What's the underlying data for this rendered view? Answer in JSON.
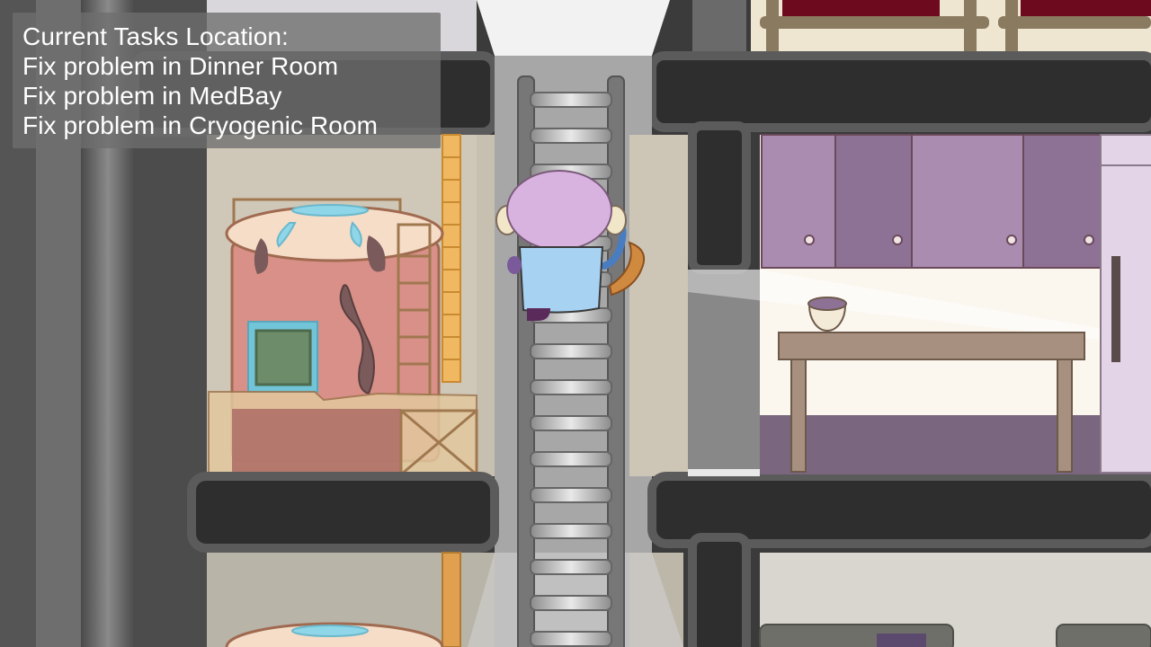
{
  "hud": {
    "tasks_title": "Current Tasks Location:",
    "tasks": [
      "Fix problem in Dinner Room",
      "Fix problem in MedBay",
      "Fix problem in Cryogenic Room"
    ]
  },
  "scene": {
    "player": "monkey-character",
    "objects": [
      "ladder",
      "cryo-tank",
      "supply-crate",
      "kitchen-cabinets",
      "kitchen-table",
      "bowl",
      "fridge"
    ],
    "colors": {
      "wall": "#3a3a3a",
      "room_floor_left": "#cfc8b8",
      "kitchen_cabinet": "#a98cb0",
      "player_head": "#d9b3e0",
      "player_body": "#a8d2f2"
    }
  }
}
